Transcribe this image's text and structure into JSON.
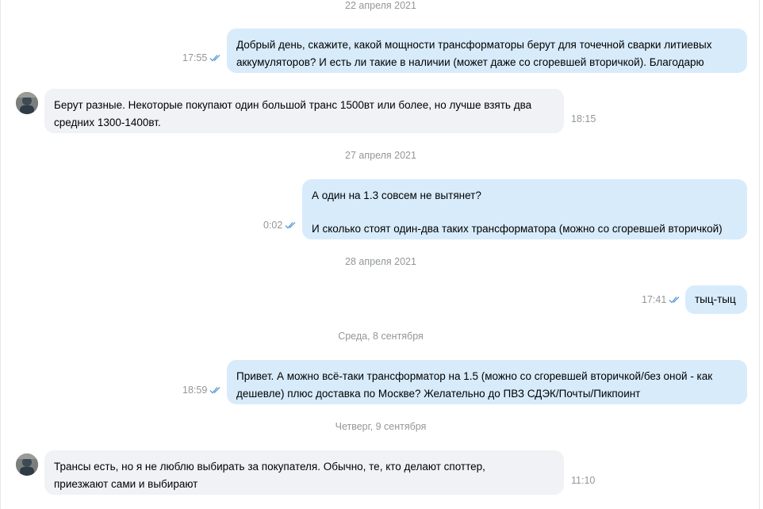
{
  "dates": [
    "22 апреля 2021",
    "27 апреля 2021",
    "28 апреля 2021",
    "Среда, 8 сентября",
    "Четверг, 9 сентября"
  ],
  "messages": [
    {
      "direction": "out",
      "time": "17:55",
      "lines": [
        "Добрый день, скажите, какой мощности трансформаторы берут для точечной сварки литиевых",
        "аккумуляторов? И есть ли такие в наличии (может даже со сгоревшей вторичкой). Благодарю"
      ]
    },
    {
      "direction": "in",
      "time": "18:15",
      "lines": [
        "Берут разные. Некоторые покупают один большой транс 1500вт или более, но лучше взять два",
        "средних 1300-1400вт."
      ]
    },
    {
      "direction": "out",
      "time": "0:02",
      "lines": [
        "А один на 1.3 совсем не вытянет?",
        "",
        "И сколько стоят один-два таких трансформатора (можно со сгоревшей вторичкой)"
      ]
    },
    {
      "direction": "out",
      "time": "17:41",
      "lines": [
        "тыц-тыц"
      ]
    },
    {
      "direction": "out",
      "time": "18:59",
      "lines": [
        "Привет. А можно всё-таки трансформатор на 1.5 (можно со сгоревшей вторичкой/без оной - как",
        "дешевле) плюс доставка по Москве? Желательно до ПВЗ СДЭК/Почты/Пикпоинт"
      ]
    },
    {
      "direction": "in",
      "time": "11:10",
      "lines": [
        "Трансы есть, но я не люблю выбирать за покупателя. Обычно, те, кто делают споттер,",
        "приезжают сами и выбирают"
      ]
    }
  ],
  "colors": {
    "outgoing_bubble": "#d7ebfb",
    "incoming_bubble": "#f0f2f5",
    "meta_text": "#939699",
    "read_check": "#5d9ad6"
  },
  "icons": {
    "read_status": "double-check-icon",
    "avatar": "user-avatar-photo"
  }
}
